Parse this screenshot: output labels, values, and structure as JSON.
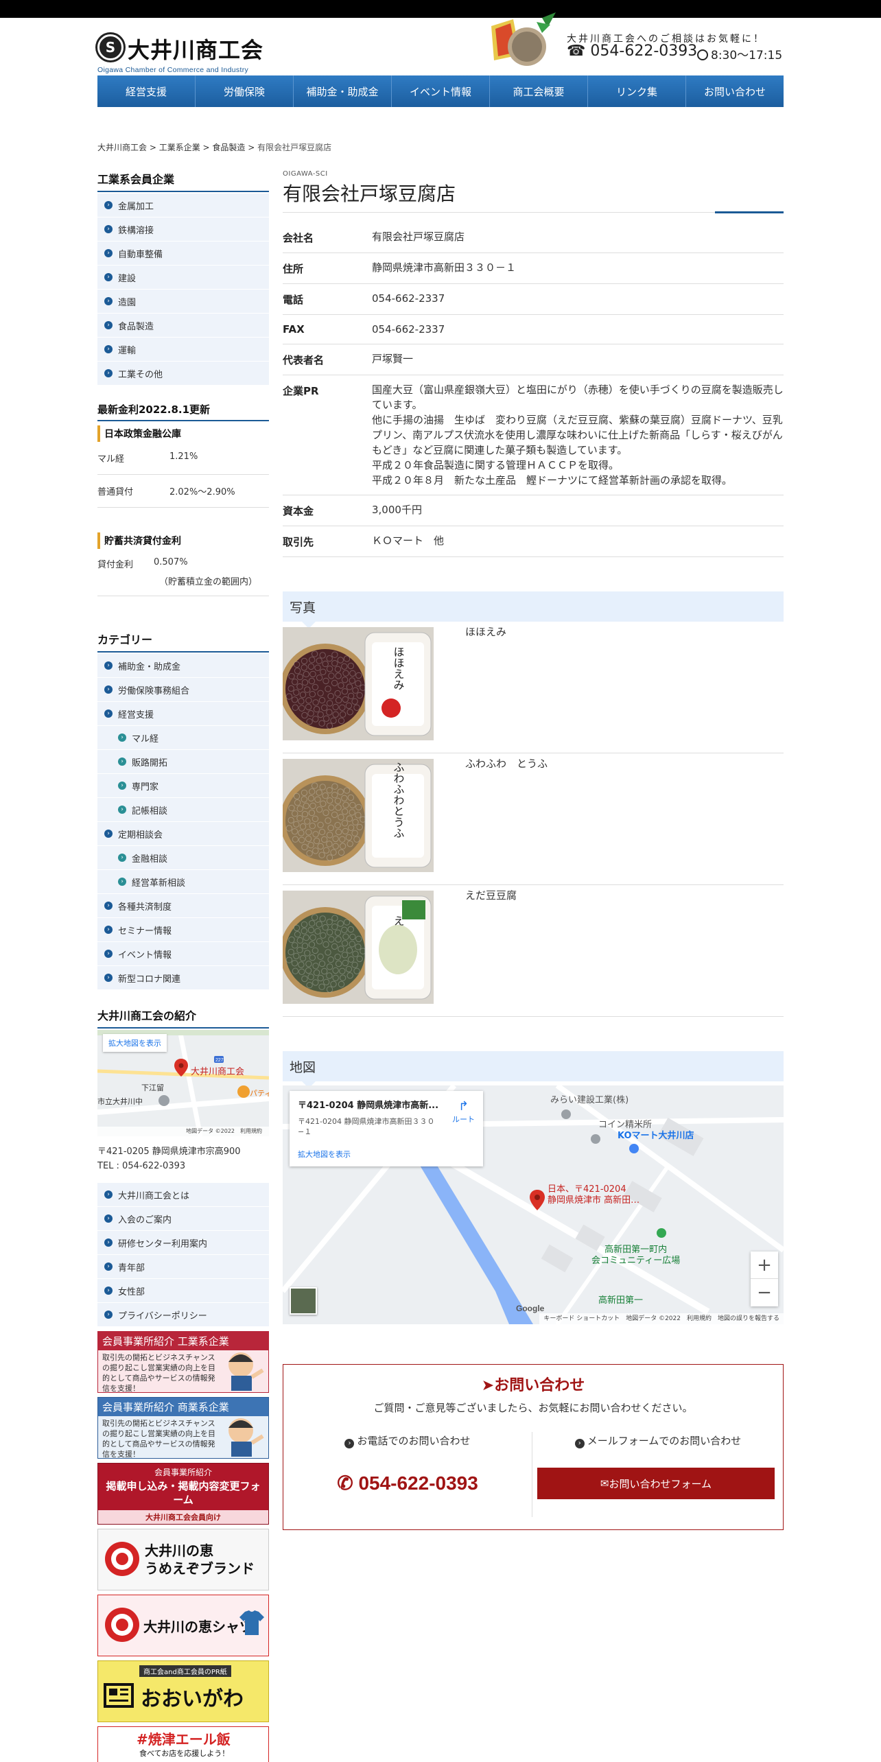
{
  "header": {
    "logo_jp": "大井川商工会",
    "logo_en": "Oigawa Chamber of Commerce and Industry",
    "tagline": "大井川商工会へのご相談はお気軽に！",
    "phone": "054-622-0393",
    "hours": "8:30〜17:15"
  },
  "nav": [
    "経営支援",
    "労働保険",
    "補助金・助成金",
    "イベント情報",
    "商工会概要",
    "リンク集",
    "お問い合わせ"
  ],
  "breadcrumb": {
    "items": [
      "大井川商工会",
      "工業系企業",
      "食品製造"
    ],
    "current": "有限会社戸塚豆腐店",
    "sep": " > "
  },
  "sidebar": {
    "members_title": "工業系会員企業",
    "members": [
      "金属加工",
      "鉄構溶接",
      "自動車整備",
      "建設",
      "造園",
      "食品製造",
      "運輸",
      "工業その他"
    ],
    "rates_title": "最新金利2022.8.1更新",
    "jfc_title": "日本政策金融公庫",
    "jfc_rates": [
      {
        "label": "マル経",
        "value": "1.21%"
      },
      {
        "label": "普通貸付",
        "value": "2.02%～2.90%"
      }
    ],
    "savings_title": "貯蓄共済貸付金利",
    "savings_label": "貸付金利",
    "savings_value": "0.507%",
    "savings_note": "（貯蓄積立金の範囲内）",
    "category_title": "カテゴリー",
    "categories": [
      {
        "label": "補助金・助成金",
        "sub": false
      },
      {
        "label": "労働保険事務組合",
        "sub": false
      },
      {
        "label": "経営支援",
        "sub": false
      },
      {
        "label": "マル経",
        "sub": true
      },
      {
        "label": "販路開拓",
        "sub": true
      },
      {
        "label": "専門家",
        "sub": true
      },
      {
        "label": "記帳相談",
        "sub": true
      },
      {
        "label": "定期相談会",
        "sub": false
      },
      {
        "label": "金融相談",
        "sub": true
      },
      {
        "label": "経営革新相談",
        "sub": true
      },
      {
        "label": "各種共済制度",
        "sub": false
      },
      {
        "label": "セミナー情報",
        "sub": false
      },
      {
        "label": "イベント情報",
        "sub": false
      },
      {
        "label": "新型コロナ関連",
        "sub": false
      }
    ],
    "intro_title": "大井川商工会の紹介",
    "mini_map": {
      "enlarge": "拡大地図を表示",
      "pin_label": "大井川商工会",
      "place1": "下江留",
      "place2": "市立大井川中",
      "place3": "パティスリ",
      "route": "227",
      "footer": "地図データ ©2022　利用規約"
    },
    "address": "〒421-0205 静岡県焼津市宗高900",
    "tel": "TEL : 054-622-0393",
    "about_links": [
      "大井川商工会とは",
      "入会のご案内",
      "研修センター利用案内",
      "青年部",
      "女性部",
      "プライバシーポリシー"
    ],
    "banners": {
      "kogyo_title": "会員事業所紹介 工業系企業",
      "kogyo_text": "取引先の開拓とビジネスチャンスの掘り起こし営業実績の向上を目的として商品やサービスの情報発信を支援！",
      "shogyo_title": "会員事業所紹介 商業系企業",
      "shogyo_text": "取引先の開拓とビジネスチャンスの掘り起こし営業実績の向上を目的として商品やサービスの情報発信を支援！",
      "apply_top": "会員事業所紹介",
      "apply_main": "掲載申し込み・掲載内容変更フォーム",
      "apply_bottom": "大井川商工会会員向け",
      "umeezo": "大井川の恵\nうめえぞブランド",
      "shirt": "大井川の恵シャツ",
      "ooigawa_top": "商工会and商工会員のPR紙",
      "ooigawa": "おおいがわ",
      "yell": "#焼津エール飯",
      "yell_sub": "食べてお店を応援しよう！"
    }
  },
  "main": {
    "en_tag": "OIGAWA-SCI",
    "title": "有限会社戸塚豆腐店",
    "info": [
      {
        "label": "会社名",
        "value": "有限会社戸塚豆腐店"
      },
      {
        "label": "住所",
        "value": "静岡県焼津市高新田３３０－１"
      },
      {
        "label": "電話",
        "value": "054-662-2337"
      },
      {
        "label": "FAX",
        "value": "054-662-2337"
      },
      {
        "label": "代表者名",
        "value": "戸塚賢一"
      },
      {
        "label": "企業PR",
        "value": "国産大豆（富山県産銀嶺大豆）と塩田にがり（赤穂）を使い手づくりの豆腐を製造販売しています。\n他に手揚の油揚　生ゆば　変わり豆腐（えだ豆豆腐、紫蘇の葉豆腐）豆腐ドーナツ、豆乳プリン、南アルプス伏流水を使用し濃厚な味わいに仕上げた新商品「しらす・桜えびがんもどき」など豆腐に関連した菓子類も製造しています。\n平成２０年食品製造に関する管理ＨＡＣＣＰを取得。\n平成２０年８月　新たな土産品　鰹ドーナツにて経営革新計画の承認を取得。"
      },
      {
        "label": "資本金",
        "value": "3,000千円"
      },
      {
        "label": "取引先",
        "value": "ＫＯマート　他"
      }
    ],
    "photos_title": "写真",
    "photos": [
      {
        "caption": "ほほえみ",
        "package_text": "ほほえみ",
        "beans": "#4a2226"
      },
      {
        "caption": "ふわふわ　とうふ",
        "package_text": "ふわふわとうふ",
        "beans": "#8a7350"
      },
      {
        "caption": "えだ豆豆腐",
        "package_text": "えだ豆",
        "beans": "#4c5940"
      }
    ],
    "map_title": "地図",
    "map": {
      "card_title": "〒421-0204 静岡県焼津市高新...",
      "card_addr": "〒421-0204 静岡県焼津市高新田３３０−１",
      "route": "ルート",
      "enlarge": "拡大地図を表示",
      "pin_label": "日本、〒421-0204\n静岡県焼津市 高新田…",
      "poi1": "みらい建設工業(株)",
      "poi2": "コイン精米所",
      "poi3": "KOマート大井川店",
      "poi4": "高新田第一町内\n会コミュニティー広場",
      "poi5": "高新田第一",
      "footer": "キーボード ショートカット　地図データ ©2022　利用規約　地図の誤りを報告する"
    },
    "contact": {
      "title": "お問い合わせ",
      "desc": "ご質問・ご意見等ございましたら、お気軽にお問い合わせください。",
      "phone_label": "お電話でのお問い合わせ",
      "phone": "054-622-0393",
      "mail_label": "メールフォームでのお問い合わせ",
      "mail_button": "お問い合わせフォーム"
    }
  },
  "colors": {
    "brand_blue": "#1b5a96",
    "accent_red": "#a01414",
    "side_bg": "#eef3fa",
    "section_bg": "#e6f0fc"
  }
}
